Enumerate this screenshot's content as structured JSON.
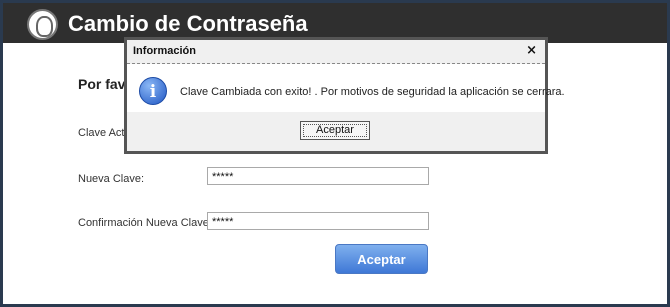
{
  "header": {
    "title": "Cambio de Contraseña"
  },
  "form": {
    "heading": "Por fav",
    "current_label": "Clave Actu",
    "new_label": "Nueva Clave:",
    "new_value": "*****",
    "confirm_label": "Confirmación Nueva Clave:",
    "confirm_value": "*****",
    "submit_label": "Aceptar"
  },
  "dialog": {
    "title": "Información",
    "close": "×",
    "message": "Clave Cambiada con exito! . Por motivos de seguridad la aplicación se cerrara.",
    "ok_label": "Aceptar"
  }
}
